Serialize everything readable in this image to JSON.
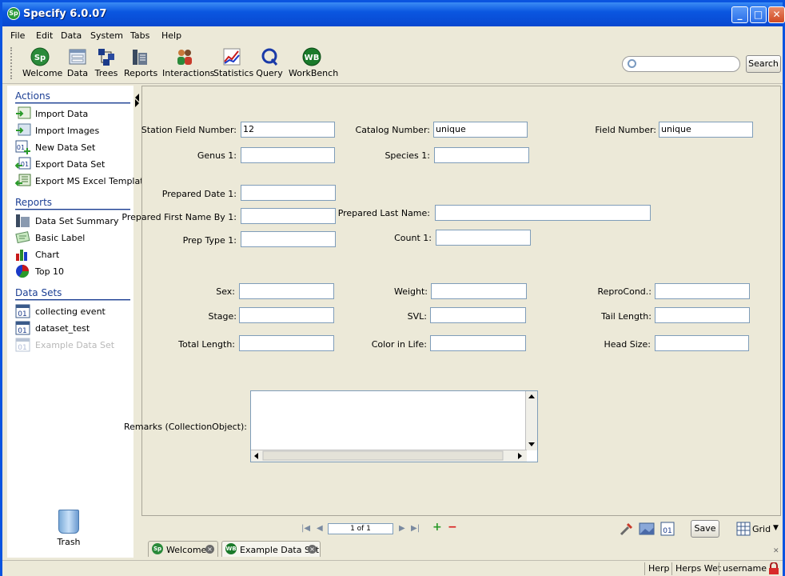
{
  "window": {
    "title": "Specify 6.0.07"
  },
  "menu": [
    "File",
    "Edit",
    "Data",
    "System",
    "Tabs",
    "Help"
  ],
  "toolbar": {
    "items": [
      "Welcome",
      "Data",
      "Trees",
      "Reports",
      "Interactions",
      "Statistics",
      "Query",
      "WorkBench"
    ],
    "search_label": "Search"
  },
  "sidebar": {
    "actions": {
      "title": "Actions",
      "items": [
        "Import Data",
        "Import Images",
        "New Data Set",
        "Export Data Set",
        "Export MS Excel Template"
      ]
    },
    "reports": {
      "title": "Reports",
      "items": [
        "Data Set Summary",
        "Basic Label",
        "Chart",
        "Top 10"
      ]
    },
    "datasets": {
      "title": "Data Sets",
      "items": [
        "collecting event",
        "dataset_test",
        "Example Data Set"
      ]
    },
    "trash_label": "Trash"
  },
  "form": {
    "station_field_number": {
      "label": "Station Field Number:",
      "value": "12"
    },
    "catalog_number": {
      "label": "Catalog Number:",
      "value": "unique"
    },
    "field_number": {
      "label": "Field Number:",
      "value": "unique"
    },
    "genus": {
      "label": "Genus 1:",
      "value": ""
    },
    "species": {
      "label": "Species 1:",
      "value": ""
    },
    "prepared_date": {
      "label": "Prepared Date 1:",
      "value": ""
    },
    "prepared_first_name": {
      "label": "Prepared First Name By 1:",
      "value": ""
    },
    "prepared_last_name": {
      "label": "Prepared Last Name:",
      "value": ""
    },
    "prep_type": {
      "label": "Prep Type 1:",
      "value": ""
    },
    "count": {
      "label": "Count 1:",
      "value": ""
    },
    "sex": {
      "label": "Sex:",
      "value": ""
    },
    "weight": {
      "label": "Weight:",
      "value": ""
    },
    "reprocond": {
      "label": "ReproCond.:",
      "value": ""
    },
    "stage": {
      "label": "Stage:",
      "value": ""
    },
    "svl": {
      "label": "SVL:",
      "value": ""
    },
    "tail_length": {
      "label": "Tail Length:",
      "value": ""
    },
    "total_length": {
      "label": "Total Length:",
      "value": ""
    },
    "color_in_life": {
      "label": "Color in Life:",
      "value": ""
    },
    "head_size": {
      "label": "Head Size:",
      "value": ""
    },
    "remarks": {
      "label": "Remarks (CollectionObject):",
      "value": ""
    }
  },
  "record_nav": {
    "position": "1 of 1",
    "save_label": "Save",
    "grid_label": "Grid"
  },
  "tabs": [
    {
      "label": "Welcome"
    },
    {
      "label": "Example Data Set"
    }
  ],
  "status": {
    "discipline": "Herp",
    "collection": "Herps Wet",
    "user": "username"
  }
}
